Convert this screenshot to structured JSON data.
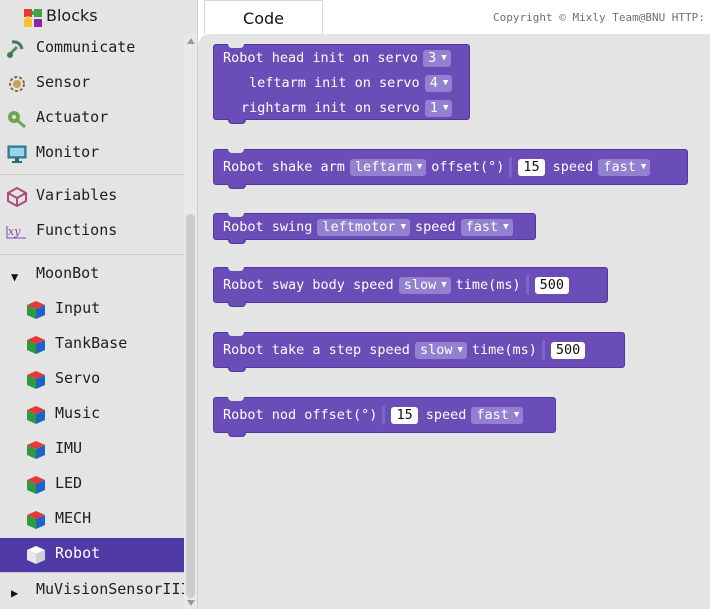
{
  "sidebar": {
    "title": "Blocks",
    "categories": [
      {
        "label": "Communicate",
        "icon": "communicate-icon"
      },
      {
        "label": "Sensor",
        "icon": "sensor-icon"
      },
      {
        "label": "Actuator",
        "icon": "actuator-icon"
      },
      {
        "label": "Monitor",
        "icon": "monitor-icon"
      },
      {
        "label": "Variables",
        "icon": "variables-icon"
      },
      {
        "label": "Functions",
        "icon": "functions-icon"
      }
    ],
    "group": {
      "label": "MoonBot",
      "expanded": true
    },
    "subitems": [
      {
        "label": "Input"
      },
      {
        "label": "TankBase"
      },
      {
        "label": "Servo"
      },
      {
        "label": "Music"
      },
      {
        "label": "IMU"
      },
      {
        "label": "LED"
      },
      {
        "label": "MECH"
      },
      {
        "label": "Robot",
        "selected": true
      }
    ],
    "collapsed_group": {
      "label": "MuVisionSensorIII",
      "expanded": false
    }
  },
  "tabs": {
    "code": "Code"
  },
  "copyright": "Copyright © Mixly Team@BNU HTTP:",
  "blocks": {
    "init": {
      "head_text": "Robot head init on servo",
      "head_value": "3",
      "leftarm_text": "leftarm init on servo",
      "leftarm_value": "4",
      "rightarm_text": "rightarm init on servo",
      "rightarm_value": "1"
    },
    "shake": {
      "text": "Robot shake arm",
      "arm": "leftarm",
      "offset_label": "offset(°)",
      "offset": "15",
      "speed_label": "speed",
      "speed": "fast"
    },
    "swing": {
      "text": "Robot swing",
      "motor": "leftmotor",
      "speed_label": "speed",
      "speed": "fast"
    },
    "sway": {
      "text": "Robot sway body speed",
      "speed": "slow",
      "time_label": "time(ms)",
      "time": "500"
    },
    "step": {
      "text": "Robot take a step speed",
      "speed": "slow",
      "time_label": "time(ms)",
      "time": "500"
    },
    "nod": {
      "text": "Robot nod offset(°)",
      "offset": "15",
      "speed_label": "speed",
      "speed": "fast"
    }
  },
  "colors": {
    "block_purple": "#6b4db8",
    "dropdown_purple": "#9380d0",
    "selected_category": "#4f3aa6",
    "workspace_bg": "#e4e4e4"
  }
}
